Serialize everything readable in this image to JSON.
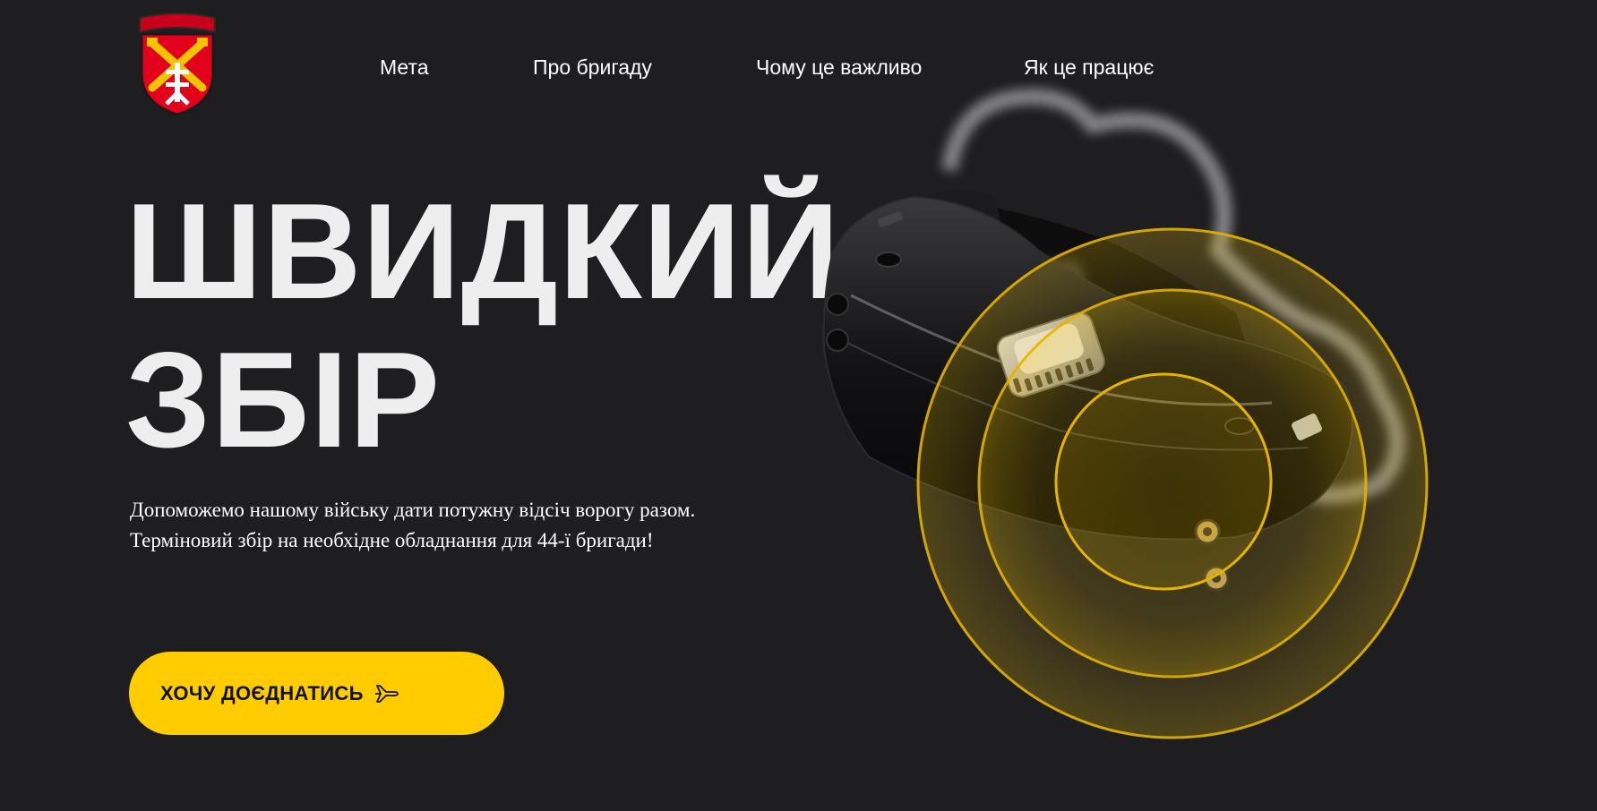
{
  "logo": {
    "icon": "brigade-shield-emblem-icon",
    "banner_text": "",
    "colors": {
      "shield": "#e3001b",
      "cross": "#f5c400",
      "outline": "#1a1a1a"
    }
  },
  "nav": {
    "items": [
      {
        "label": "Мета"
      },
      {
        "label": "Про бригаду"
      },
      {
        "label": "Чому це важливо"
      },
      {
        "label": "Як це працює"
      }
    ]
  },
  "hero": {
    "title_line1": "ШВИДКИЙ",
    "title_line2": "ЗБІР",
    "subtitle_line1": "Допоможемо нашому війську дати потужну відсіч ворогу разом.",
    "subtitle_line2": "Терміновий збір на необхідне обладнання для 44-ї бригади!"
  },
  "cta": {
    "label": "ХОЧУ ДОЄДНАТИСЬ",
    "icon": "airplane-icon"
  },
  "illustration": {
    "icon": "fpv-goggles-illustration",
    "accent": "#ffcc00"
  },
  "colors": {
    "background": "#1e1e21",
    "accent": "#ffcc00",
    "text": "#ffffff"
  }
}
